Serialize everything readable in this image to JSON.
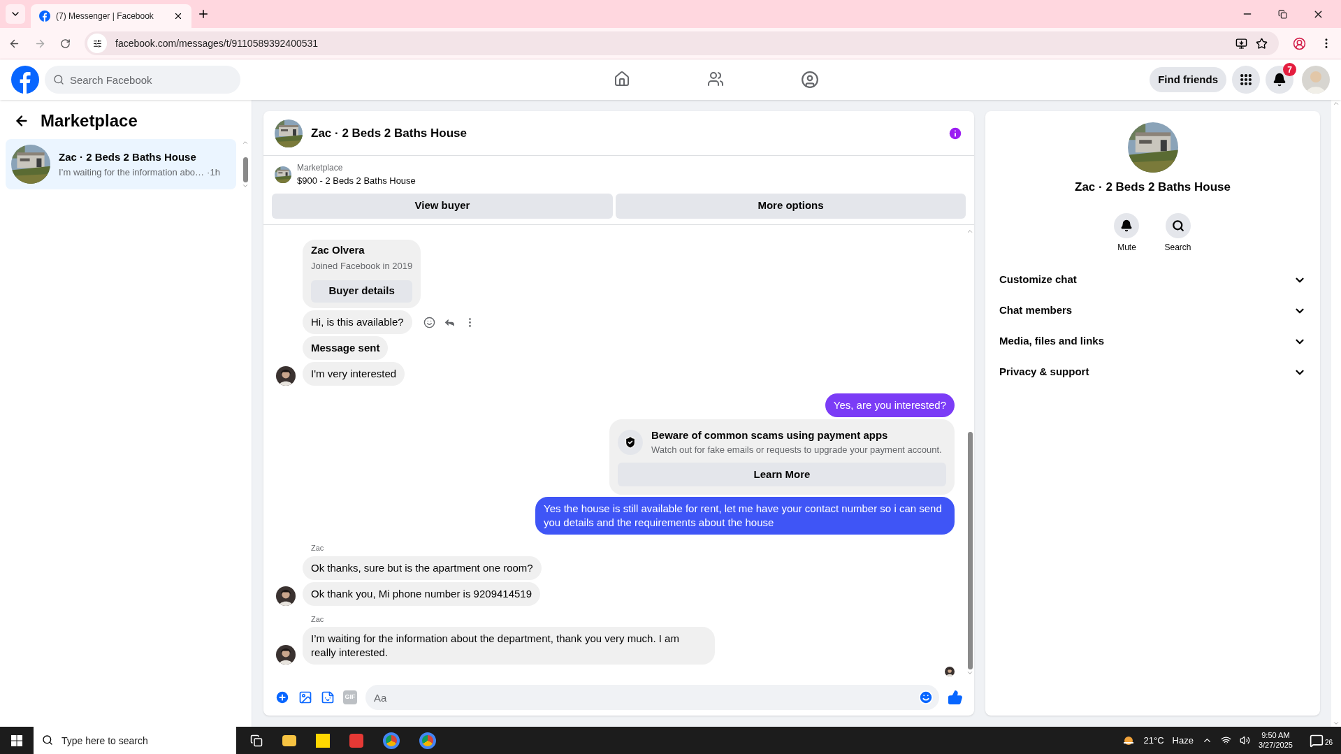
{
  "browser": {
    "tab_title": "(7) Messenger | Facebook",
    "url": "facebook.com/messages/t/9110589392400531"
  },
  "header": {
    "search_placeholder": "Search Facebook",
    "find_friends": "Find friends",
    "notification_count": "7"
  },
  "sidebar": {
    "title": "Marketplace",
    "conversations": [
      {
        "name": "Zac · 2 Beds 2 Baths House",
        "preview": "I’m waiting for the information abo…",
        "time": "·1h",
        "selected": true
      }
    ]
  },
  "chat": {
    "title": "Zac · 2 Beds 2 Baths House",
    "listing": {
      "label": "Marketplace",
      "item": "$900 - 2 Beds 2 Baths House"
    },
    "buttons": [
      "View buyer",
      "More options"
    ],
    "buyer_card": {
      "name": "Zac Olvera",
      "joined": "Joined Facebook in 2019",
      "button": "Buyer details"
    },
    "messages": [
      {
        "kind": "incoming",
        "text": "Hi, is this available?",
        "avatar": false,
        "hovered": true
      },
      {
        "kind": "status",
        "text": "Message sent"
      },
      {
        "kind": "incoming",
        "text": "I'm very interested",
        "avatar": true,
        "hovered": false
      },
      {
        "kind": "outgoing",
        "text": "Yes, are you interested?",
        "color": "#7b3cf6"
      },
      {
        "kind": "notice",
        "title": "Beware of common scams using payment apps",
        "text": "Watch out for fake emails or requests to upgrade your payment account.",
        "button": "Learn More"
      },
      {
        "kind": "outgoing",
        "text": "Yes the house is still available for rent, let me have your contact number so i can send you details and the requirements about the house",
        "color": "#3f55f6"
      },
      {
        "kind": "incoming",
        "sender": "Zac",
        "text": "Ok thanks, sure but is the apartment one room?",
        "avatar": false,
        "hovered": false
      },
      {
        "kind": "incoming",
        "text": "Ok thank you, Mi phone number is 9209414519",
        "avatar": true,
        "hovered": false
      },
      {
        "kind": "incoming",
        "sender": "Zac",
        "text": "I’m waiting for the information about the department, thank you very much. I am really interested.",
        "avatar": true,
        "hovered": false
      }
    ],
    "gif_label": "GIF",
    "composer_placeholder": "Aa"
  },
  "details": {
    "title": "Zac · 2 Beds 2 Baths House",
    "actions": [
      {
        "kind": "mute",
        "label": "Mute"
      },
      {
        "kind": "search",
        "label": "Search"
      }
    ],
    "sections": [
      {
        "label": "Customize chat",
        "expanded": false
      },
      {
        "label": "Chat members",
        "expanded": false
      },
      {
        "label": "Media, files and links",
        "expanded": false
      },
      {
        "label": "Privacy & support",
        "expanded": false
      }
    ]
  },
  "taskbar": {
    "search_placeholder": "Type here to search",
    "temperature": "21°C",
    "weather": "Haze",
    "time": "9:50 AM",
    "date": "3/27/2025",
    "notification_count": "26"
  }
}
